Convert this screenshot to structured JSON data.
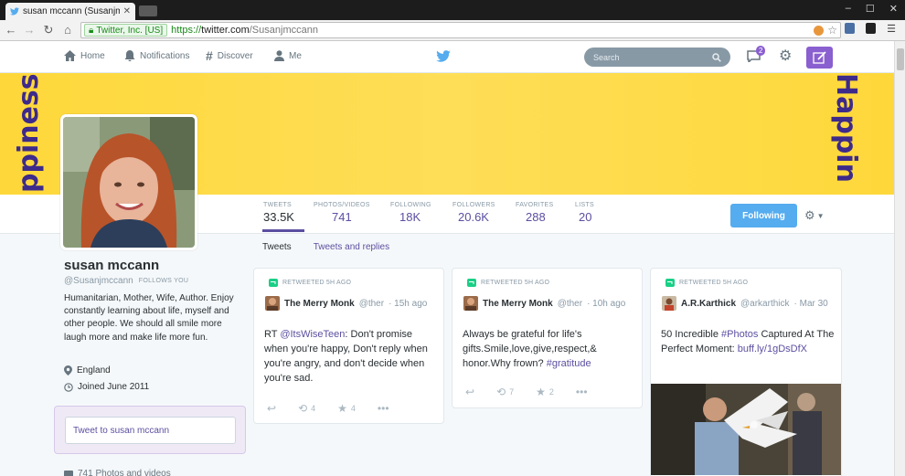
{
  "browser": {
    "tab_title": "susan mccann (Susanjmc",
    "ev_label": "Twitter, Inc. [US]",
    "url_scheme": "https://",
    "url_host": "twitter.com",
    "url_path": "/Susanjmccann"
  },
  "topnav": {
    "items": [
      {
        "label": "Home",
        "icon": "home-icon"
      },
      {
        "label": "Notifications",
        "icon": "bell-icon"
      },
      {
        "label": "Discover",
        "icon": "hash-icon"
      },
      {
        "label": "Me",
        "icon": "person-icon"
      }
    ],
    "search_placeholder": "Search",
    "dm_count": "2",
    "brand_color": "#55acee",
    "theme_color": "#8a5fd0"
  },
  "banner": {
    "left_word": "ppiness",
    "right_word": "Happin",
    "bg_color": "#fed83a"
  },
  "stats": [
    {
      "label": "TWEETS",
      "value": "33.5K"
    },
    {
      "label": "PHOTOS/VIDEOS",
      "value": "741"
    },
    {
      "label": "FOLLOWING",
      "value": "18K"
    },
    {
      "label": "FOLLOWERS",
      "value": "20.6K"
    },
    {
      "label": "FAVORITES",
      "value": "288"
    },
    {
      "label": "LISTS",
      "value": "20"
    }
  ],
  "following_button": "Following",
  "profile": {
    "name": "susan mccann",
    "handle": "@Susanjmccann",
    "follows_you": "FOLLOWS YOU",
    "bio": "Humanitarian, Mother, Wife, Author. Enjoy constantly learning about life, myself and other people. We should all smile more laugh more and make life more fun.",
    "location": "England",
    "joined": "Joined June 2011",
    "tweet_to": "Tweet to susan mccann",
    "photos_videos": "741 Photos and videos"
  },
  "timeline_tabs": [
    {
      "label": "Tweets",
      "active": true
    },
    {
      "label": "Tweets and replies",
      "active": false
    }
  ],
  "tweets": [
    {
      "retweeted": "RETWEETED 5H AGO",
      "author": "The Merry Monk",
      "handle": "@ther",
      "time": "· 15h ago",
      "text_parts": [
        "RT ",
        "@ItsWiseTeen",
        ": Don't promise when you're happy, Don't reply when you're angry, and don't decide when you're sad."
      ],
      "retweets": "4",
      "favorites": "4"
    },
    {
      "retweeted": "RETWEETED 5H AGO",
      "author": "The Merry Monk",
      "handle": "@ther",
      "time": "· 10h ago",
      "text_parts": [
        "Always be grateful for life's gifts.Smile,love,give,respect,& honor.Why frown? ",
        "#gratitude"
      ],
      "retweets": "7",
      "favorites": "2"
    },
    {
      "retweeted": "RETWEETED 5H AGO",
      "author": "A.R.Karthick",
      "handle": "@arkarthick",
      "time": "· Mar 30",
      "text_parts": [
        "50 Incredible ",
        "#Photos",
        " Captured At The Perfect Moment: ",
        "buff.ly/1gDsDfX"
      ]
    }
  ]
}
